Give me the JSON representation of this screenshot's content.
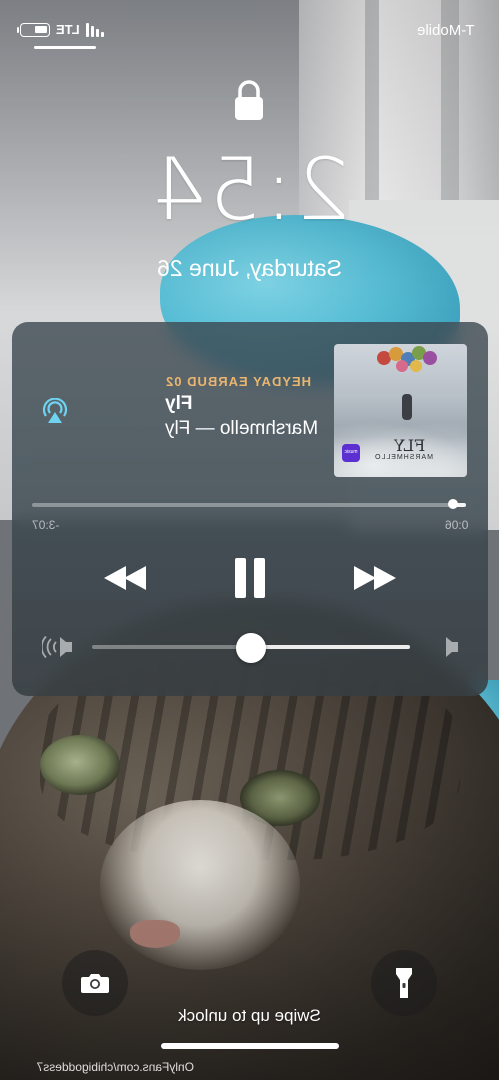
{
  "status_bar": {
    "carrier": "T-Mobile",
    "network": "LTE",
    "signal_bars": 4
  },
  "lock_screen": {
    "time": "2:54",
    "date": "Saturday, June 26",
    "lock_icon": "lock-icon"
  },
  "now_playing": {
    "device": "HEYDAY EARBUD 02",
    "title": "Fly",
    "subtitle": "Marshmello — Fly",
    "elapsed": "0:06",
    "remaining": "-3:07",
    "progress": 0.03,
    "volume": 0.5,
    "artwork": {
      "title": "FLY",
      "artist": "MARSHMELLO",
      "badge": "music"
    },
    "icons": {
      "airplay": "airplay-audio-icon",
      "rewind": "rewind-icon",
      "pause": "pause-icon",
      "forward": "fast-forward-icon",
      "volume_max": "volume-high-icon",
      "volume_min": "volume-low-icon"
    },
    "colors": {
      "device_label": "#e9b56f",
      "airplay": "#6fd3f0"
    }
  },
  "bottom": {
    "swipe_hint": "Swipe up to unlock",
    "camera_icon": "camera-icon",
    "flashlight_icon": "flashlight-icon",
    "watermark": "OnlyFans.com/chibigoddess7"
  }
}
